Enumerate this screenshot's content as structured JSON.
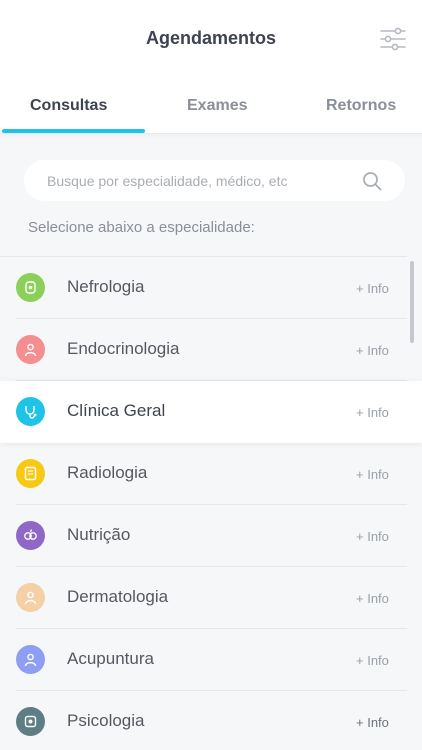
{
  "header": {
    "title": "Agendamentos",
    "filter_icon": "sliders-icon"
  },
  "tabs": [
    {
      "label": "Consultas",
      "active": true
    },
    {
      "label": "Exames",
      "active": false
    },
    {
      "label": "Retornos",
      "active": false
    }
  ],
  "search": {
    "placeholder": "Busque por especialidade, médico, etc",
    "value": "",
    "icon": "search-icon"
  },
  "instruction": "Selecione abaixo a especialidade:",
  "specialties": [
    {
      "label": "Nefrologia",
      "info": "+ Info",
      "color": "#8ccf5a",
      "icon": "kidney-icon"
    },
    {
      "label": "Endocrinologia",
      "info": "+ Info",
      "color": "#f58e8e",
      "icon": "doctor-icon"
    },
    {
      "label": "Clínica Geral",
      "info": "+ Info",
      "color": "#1fc3e8",
      "icon": "stethoscope-icon",
      "selected": true
    },
    {
      "label": "Radiologia",
      "info": "+ Info",
      "color": "#f6c915",
      "icon": "xray-icon"
    },
    {
      "label": "Nutrição",
      "info": "+ Info",
      "color": "#8e67c7",
      "icon": "nutrition-icon"
    },
    {
      "label": "Dermatologia",
      "info": "+ Info",
      "color": "#f5cfa5",
      "icon": "skin-icon"
    },
    {
      "label": "Acupuntura",
      "info": "+ Info",
      "color": "#8e9ef2",
      "icon": "acupuncture-icon"
    },
    {
      "label": "Psicologia",
      "info": "+ Info",
      "color": "#5f7d84",
      "icon": "brain-icon"
    }
  ],
  "colors": {
    "accent": "#1fc3e8",
    "title": "#3e4350",
    "muted": "#8a8f98"
  }
}
